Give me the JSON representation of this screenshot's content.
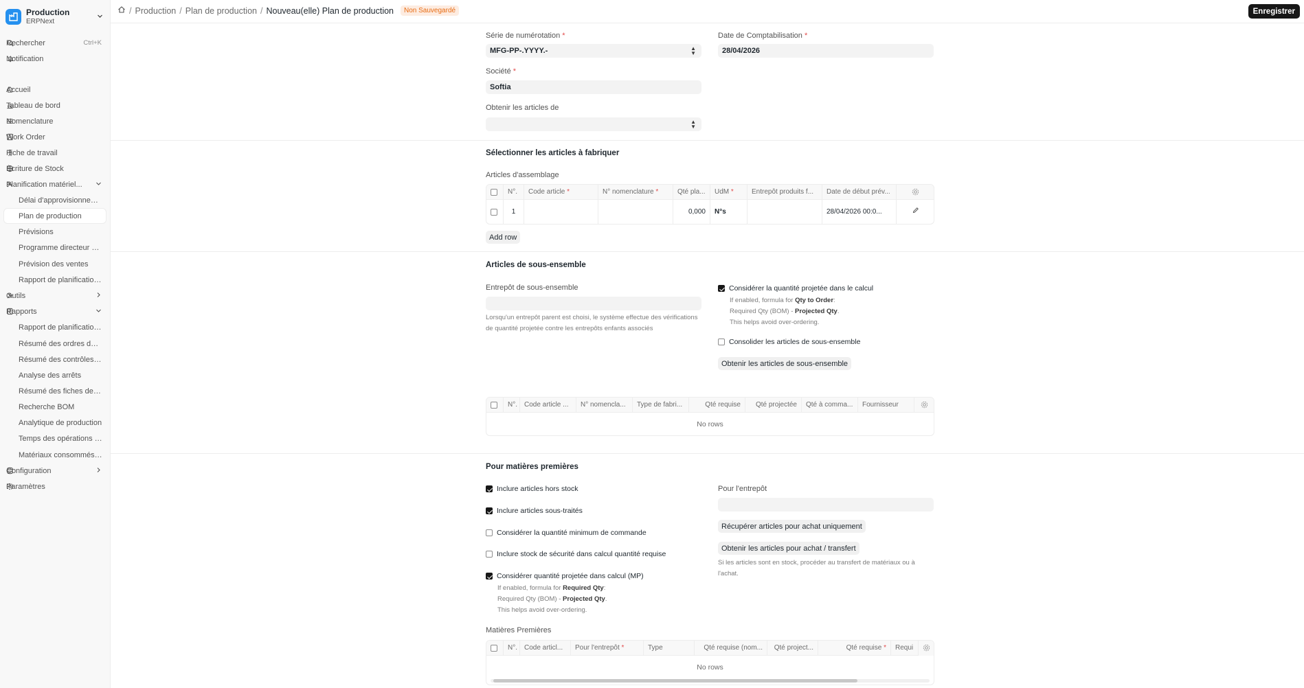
{
  "app": {
    "title": "Production",
    "subtitle": "ERPNext"
  },
  "sidebar": {
    "search": {
      "label": "Rechercher",
      "shortcut": "Ctrl+K"
    },
    "notification": "Notification",
    "items": [
      {
        "label": "Accueil",
        "icon": "home-icon"
      },
      {
        "label": "Tableau de bord",
        "icon": "chart-icon"
      },
      {
        "label": "Nomenclature",
        "icon": "list-icon"
      },
      {
        "label": "Work Order",
        "icon": "document-icon"
      },
      {
        "label": "Fiche de travail",
        "icon": "person-icon"
      },
      {
        "label": "Écriture de Stock",
        "icon": "globe-icon"
      },
      {
        "label": "Planification matériel...",
        "icon": "tools-icon",
        "expanded": true
      },
      {
        "label": "Délai d'approvisionneme...",
        "child": true
      },
      {
        "label": "Plan de production",
        "child": true,
        "active": true
      },
      {
        "label": "Prévisions",
        "child": true
      },
      {
        "label": "Programme directeur de ...",
        "child": true
      },
      {
        "label": "Prévision des ventes",
        "child": true
      },
      {
        "label": "Rapport de planification ...",
        "child": true
      },
      {
        "label": "Outils",
        "icon": "tools-icon",
        "collapsed": true
      },
      {
        "label": "Rapports",
        "icon": "report-icon",
        "expanded": true
      },
      {
        "label": "Rapport de planification ...",
        "child": true
      },
      {
        "label": "Résumé des ordres de fa...",
        "child": true
      },
      {
        "label": "Résumé des contrôles qu...",
        "child": true
      },
      {
        "label": "Analyse des arrêts",
        "child": true
      },
      {
        "label": "Résumé des fiches de tra...",
        "child": true
      },
      {
        "label": "Recherche BOM",
        "child": true
      },
      {
        "label": "Analytique de production",
        "child": true
      },
      {
        "label": "Temps des opérations B...",
        "child": true
      },
      {
        "label": "Matériaux consommés or...",
        "child": true
      },
      {
        "label": "Configuration",
        "icon": "database-icon",
        "collapsed": true
      },
      {
        "label": "Paramètres",
        "icon": "gear-icon"
      }
    ]
  },
  "breadcrumb": {
    "items": [
      "Production",
      "Plan de production"
    ],
    "current": "Nouveau(elle) Plan de production",
    "status": "Non Sauvegardé"
  },
  "toolbar": {
    "save_label": "Enregistrer"
  },
  "form": {
    "naming_series": {
      "label": "Série de numérotation",
      "value": "MFG-PP-.YYYY.-"
    },
    "posting_date": {
      "label": "Date de Comptabilisation",
      "value": "28/04/2026"
    },
    "company": {
      "label": "Société",
      "value": "Softia"
    },
    "get_items_from": {
      "label": "Obtenir les articles de",
      "value": ""
    }
  },
  "section_assembly": {
    "title": "Sélectionner les articles à fabriquer",
    "table_label": "Articles d'assemblage",
    "columns": [
      "N°.",
      "Code article",
      "N° nomenclature",
      "Qté pla...",
      "UdM",
      "Entrepôt produits f...",
      "Date de début prév..."
    ],
    "rows": [
      {
        "no": "1",
        "item_code": "",
        "bom": "",
        "qty": "0,000",
        "uom": "N°s",
        "warehouse": "",
        "start_date": "28/04/2026 00:0..."
      }
    ],
    "add_row": "Add row"
  },
  "section_sub": {
    "title": "Articles de sous-ensemble",
    "warehouse_label": "Entrepôt de sous-ensemble",
    "warehouse_help": "Lorsqu'un entrepôt parent est choisi, le système effectue des vérifications de quantité projetée contre les entrepôts enfants associés",
    "consider_projected": {
      "label": "Considérer la quantité projetée dans le calcul",
      "checked": true,
      "help1a": "If enabled, formula for ",
      "help1b": "Qty to Order",
      "help1c": ":",
      "help2a": "Required Qty (BOM) - ",
      "help2b": "Projected Qty",
      "help2c": ".",
      "help3": "This helps avoid over-ordering."
    },
    "consolidate": {
      "label": "Consolider les articles de sous-ensemble",
      "checked": false
    },
    "get_button": "Obtenir les articles de sous-ensemble",
    "columns": [
      "N°.",
      "Code article ...",
      "N° nomencla...",
      "Type de fabri...",
      "Qté requise",
      "Qté projectée",
      "Qté à comma...",
      "Fournisseur"
    ],
    "no_rows": "No rows"
  },
  "section_raw": {
    "title": "Pour matières premières",
    "checks": [
      {
        "label": "Inclure articles hors stock",
        "checked": true
      },
      {
        "label": "Inclure articles sous-traités",
        "checked": true
      },
      {
        "label": "Considérer la quantité minimum de commande",
        "checked": false
      },
      {
        "label": "Inclure stock de sécurité dans calcul quantité requise",
        "checked": false
      },
      {
        "label": "Considérer quantité projetée dans calcul (MP)",
        "checked": true
      }
    ],
    "mp_help": {
      "l1a": "If enabled, formula for ",
      "l1b": "Required Qty",
      "l1c": ":",
      "l2a": "Required Qty (BOM) - ",
      "l2b": "Projected Qty",
      "l2c": ".",
      "l3": "This helps avoid over-ordering."
    },
    "warehouse_label": "Pour l'entrepôt",
    "btn_purchase_only": "Récupérer articles pour achat uniquement",
    "btn_purchase_transfer": "Obtenir les articles pour achat / transfert",
    "transfer_help": "Si les articles sont en stock, procéder au transfert de matériaux ou à l'achat.",
    "table_label": "Matières Premières",
    "columns": [
      "N°.",
      "Code articl...",
      "Pour l'entrepôt",
      "Type",
      "Qté requise (nom...",
      "Qté project...",
      "Qté requise",
      "Requi"
    ],
    "no_rows": "No rows"
  }
}
